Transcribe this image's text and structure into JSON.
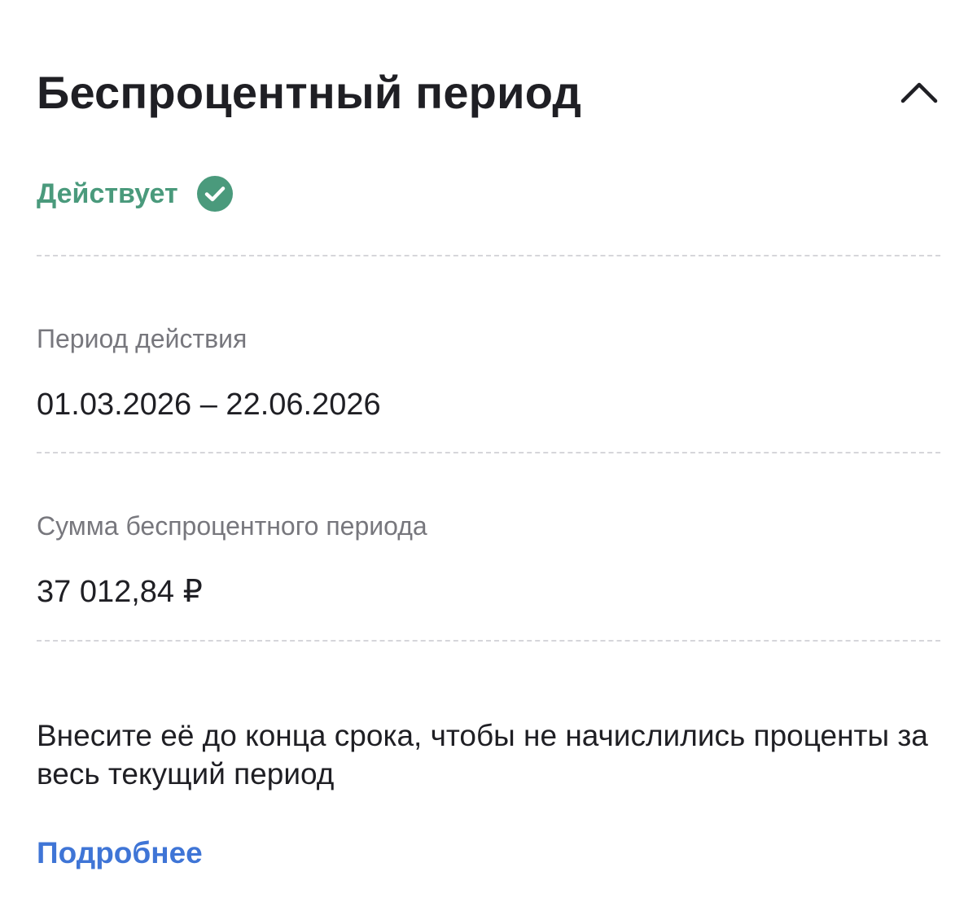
{
  "header": {
    "title": "Беспроцентный период",
    "collapse_icon": "chevron-up-icon"
  },
  "status": {
    "text": "Действует",
    "icon": "check-circle-icon",
    "color": "#4a9a7c"
  },
  "period": {
    "label": "Период действия",
    "value": "01.03.2026 – 22.06.2026"
  },
  "amount": {
    "label": "Сумма беспроцентного периода",
    "value": "37 012,84 ₽"
  },
  "note": {
    "text": "Внесите её до конца срока, чтобы не начислились проценты за весь текущий период"
  },
  "link": {
    "label": "Подробнее",
    "color": "#3f75d6"
  }
}
